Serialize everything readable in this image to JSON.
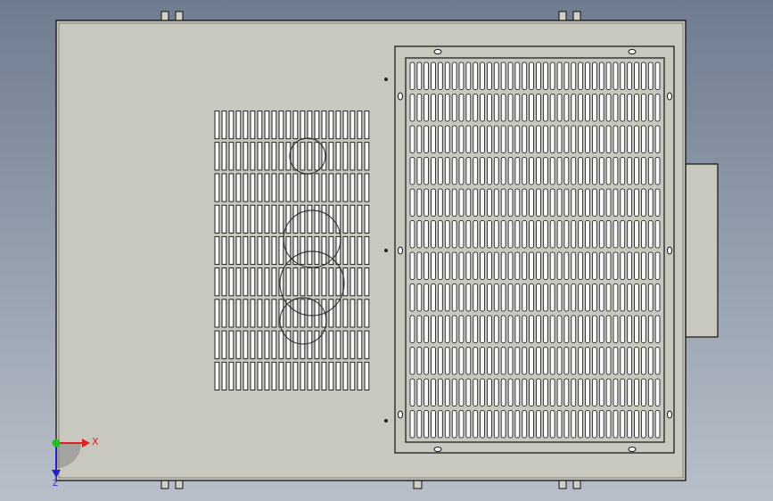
{
  "scene": {
    "background_top": "#6f7c90",
    "background_bottom": "#b8bfc9",
    "panel_fill": "#c8c8bf",
    "panel_edge": "#1a1a1a",
    "slot_fill": "#fafafa",
    "slot_edge": "#111111"
  },
  "triad": {
    "x_label": "X",
    "z_label": "Z",
    "x_color": "#e02020",
    "y_color": "#20c020",
    "z_color": "#2020d0"
  }
}
